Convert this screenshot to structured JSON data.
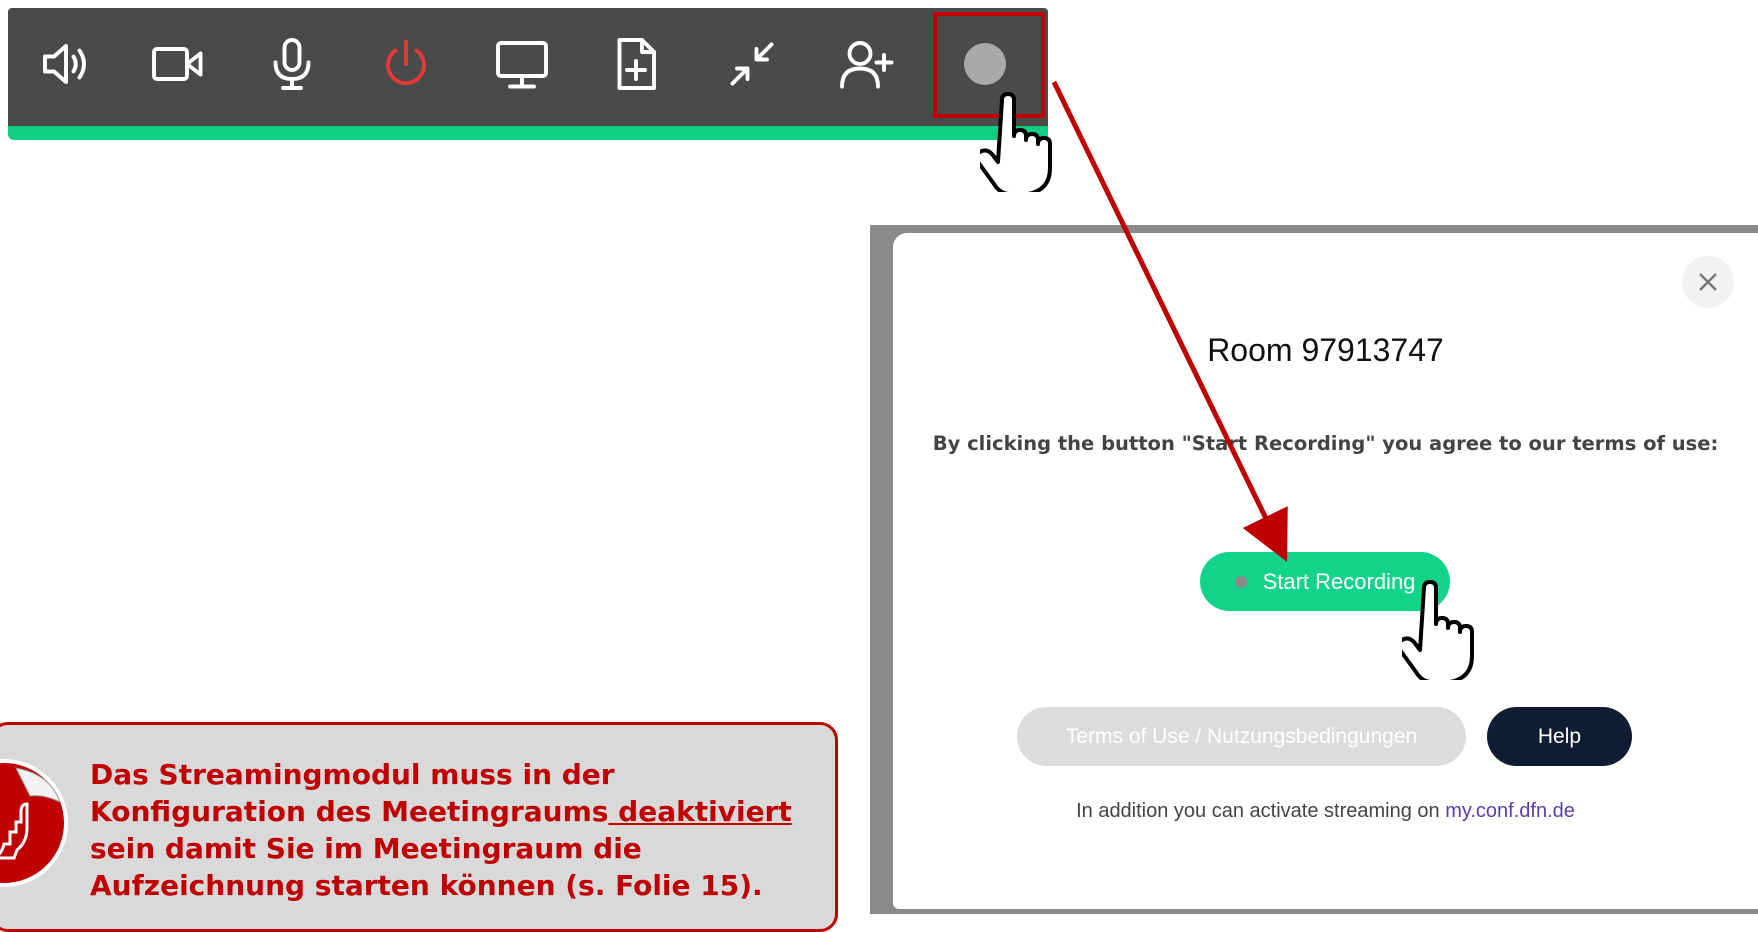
{
  "toolbar": {
    "buttons": [
      {
        "name": "speaker-icon"
      },
      {
        "name": "camera-icon"
      },
      {
        "name": "microphone-icon"
      },
      {
        "name": "power-icon",
        "color": "#e53935"
      },
      {
        "name": "screen-share-icon"
      },
      {
        "name": "add-file-icon"
      },
      {
        "name": "minimize-icon"
      },
      {
        "name": "add-user-icon"
      },
      {
        "name": "record-icon"
      }
    ],
    "accent_color": "#12cf86",
    "highlight_color": "#c00000"
  },
  "dialog": {
    "title": "Room 97913747",
    "terms_text": "By clicking the button \"Start Recording\" you agree to our terms of use:",
    "start_button": "Start Recording",
    "terms_button": "Terms of Use / Nutzungsbedingungen",
    "help_button": "Help",
    "streaming_prefix": "In addition you can activate streaming on ",
    "streaming_link": "my.conf.dfn.de",
    "close_icon": "close-icon"
  },
  "info": {
    "line_before": "Das Streamingmodul muss in der Konfiguration des Meetingraums",
    "underlined": " deaktiviert",
    "line_after": " sein damit Sie im Meetingraum die Aufzeichnung starten können (s. Folie 15).",
    "badge_icon": "raised-fist-sticker-icon"
  }
}
